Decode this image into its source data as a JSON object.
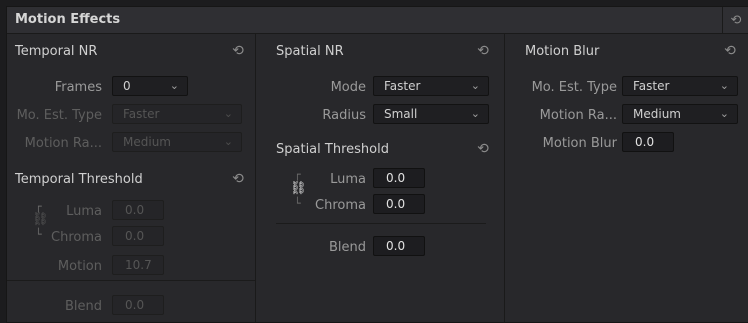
{
  "panel": {
    "title": "Motion Effects"
  },
  "temporal_nr": {
    "title": "Temporal NR",
    "frames_label": "Frames",
    "frames_value": "0",
    "mo_est_type_label": "Mo. Est. Type",
    "mo_est_type_value": "Faster",
    "motion_range_label": "Motion Ra...",
    "motion_range_value": "Medium"
  },
  "temporal_threshold": {
    "title": "Temporal Threshold",
    "luma_label": "Luma",
    "luma_value": "0.0",
    "chroma_label": "Chroma",
    "chroma_value": "0.0",
    "motion_label": "Motion",
    "motion_value": "10.7",
    "blend_label": "Blend",
    "blend_value": "0.0"
  },
  "spatial_nr": {
    "title": "Spatial NR",
    "mode_label": "Mode",
    "mode_value": "Faster",
    "radius_label": "Radius",
    "radius_value": "Small"
  },
  "spatial_threshold": {
    "title": "Spatial Threshold",
    "luma_label": "Luma",
    "luma_value": "0.0",
    "chroma_label": "Chroma",
    "chroma_value": "0.0",
    "blend_label": "Blend",
    "blend_value": "0.0"
  },
  "motion_blur": {
    "title": "Motion Blur",
    "mo_est_type_label": "Mo. Est. Type",
    "mo_est_type_value": "Faster",
    "motion_range_label": "Motion Ra...",
    "motion_range_value": "Medium",
    "motion_blur_label": "Motion Blur",
    "motion_blur_value": "0.0"
  },
  "icons": {
    "reset": "reset-icon",
    "link": "link-icon",
    "chevron": "chevron-down-icon"
  },
  "colors": {
    "panel_bg": "#28282b",
    "field_bg": "#1f1f22",
    "text": "#b8b8b8"
  }
}
